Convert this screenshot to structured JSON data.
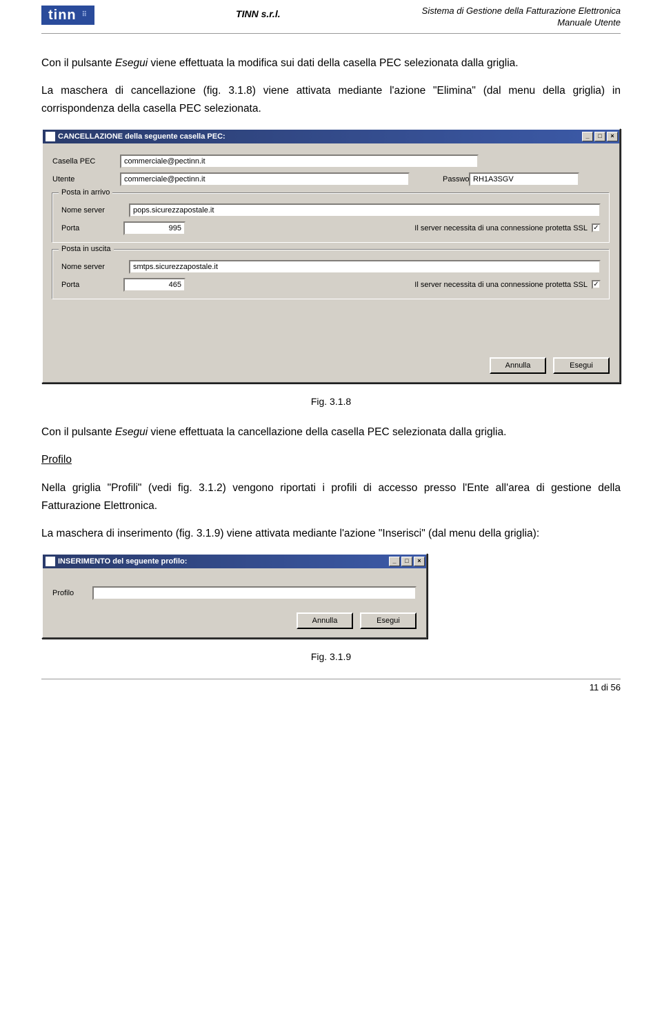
{
  "header": {
    "logo_text": "tinn",
    "company": "TINN s.r.l.",
    "doc_title": "Sistema di Gestione della Fatturazione Elettronica",
    "doc_sub": "Manuale Utente"
  },
  "paragraphs": {
    "p1a": "Con il pulsante ",
    "p1_em": "Esegui",
    "p1b": " viene effettuata la modifica sui dati della casella PEC selezionata dalla griglia.",
    "p2": "La maschera di cancellazione (fig. 3.1.8) viene attivata mediante l'azione \"Elimina\" (dal menu della griglia) in corrispondenza della casella PEC selezionata.",
    "fig1": "Fig. 3.1.8",
    "p3a": "Con il pulsante ",
    "p3_em": "Esegui",
    "p3b": " viene effettuata la cancellazione della casella PEC selezionata dalla griglia.",
    "profilo": "Profilo",
    "p4": "Nella griglia \"Profili\" (vedi fig. 3.1.2)  vengono riportati i profili di accesso presso l'Ente all'area di gestione della Fatturazione Elettronica.",
    "p5": "La maschera di inserimento (fig. 3.1.9) viene attivata mediante l'azione \"Inserisci\" (dal menu della griglia):",
    "fig2": "Fig. 3.1.9"
  },
  "dialog1": {
    "title": "CANCELLAZIONE della seguente casella PEC:",
    "labels": {
      "casella": "Casella PEC",
      "utente": "Utente",
      "password": "Password",
      "posta_in_arrivo": "Posta in arrivo",
      "posta_in_uscita": "Posta in uscita",
      "nome_server": "Nome server",
      "porta": "Porta",
      "ssl": "Il server necessita di una connessione protetta SSL"
    },
    "values": {
      "casella": "commerciale@pectinn.it",
      "utente": "commerciale@pectinn.it",
      "password": "RH1A3SGV",
      "in_server": "pops.sicurezzapostale.it",
      "in_porta": "995",
      "out_server": "smtps.sicurezzapostale.it",
      "out_porta": "465",
      "ssl_check": "✓"
    },
    "buttons": {
      "annulla": "Annulla",
      "esegui": "Esegui"
    }
  },
  "dialog2": {
    "title": "INSERIMENTO del seguente profilo:",
    "label_profilo": "Profilo",
    "value_profilo": "",
    "buttons": {
      "annulla": "Annulla",
      "esegui": "Esegui"
    }
  },
  "window_buttons": {
    "min": "_",
    "max": "□",
    "close": "×"
  },
  "footer": "11 di 56"
}
